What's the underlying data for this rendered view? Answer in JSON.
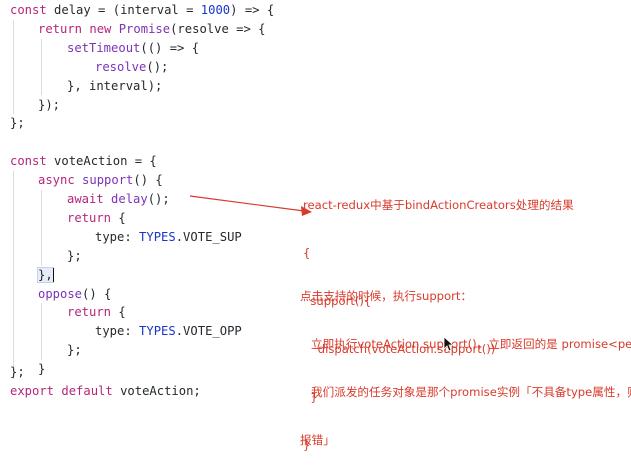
{
  "code": {
    "l1": {
      "kw1": "const ",
      "name": "delay",
      "mid": " = (interval = ",
      "num": "1000",
      "end": ") => {"
    },
    "l2": {
      "kw": "return new ",
      "cls": "Promise",
      "rest": "(resolve => {"
    },
    "l3": {
      "fn": "setTimeout",
      "rest": "(() => {"
    },
    "l4": {
      "fn": "resolve",
      "rest": "();"
    },
    "l5": "}, interval);",
    "l6": "});",
    "l7": "};",
    "l8": {
      "kw": "const ",
      "name": "voteAction",
      "rest": " = {"
    },
    "l9": {
      "kw": "async ",
      "fn": "support",
      "rest": "() {"
    },
    "l10": {
      "kw": "await ",
      "fn": "delay",
      "rest": "();"
    },
    "l11": {
      "kw": "return",
      "rest": " {"
    },
    "l12": {
      "key": "type: ",
      "const": "TYPES",
      "rest": ".VOTE_SUP"
    },
    "l13": "};",
    "l14": "},",
    "l15": {
      "fn": "oppose",
      "rest": "() {"
    },
    "l16": {
      "kw": "return",
      "rest": " {"
    },
    "l17": {
      "key": "type: ",
      "const": "TYPES",
      "rest": ".VOTE_OPP"
    },
    "l18": "};",
    "l19": "}",
    "l20": "};",
    "l21": {
      "kw": "export default ",
      "rest": "voteAction;"
    }
  },
  "annotations": {
    "note1": {
      "title": "react-redux中基于bindActionCreators处理的结果",
      "lines": [
        "{",
        "  support(){",
        "    dispatch(voteAction.support())",
        "  }",
        "}"
      ]
    },
    "note2": {
      "lines": [
        "点击支持的时候，执行support：",
        "   立即执行voteAction.support()，立即返回的是 promise<pending>",
        "   我们派发的任务对象是那个promise实例「不具备type属性，则",
        "报错」"
      ]
    }
  },
  "colors": {
    "annotation": "#d93a2b",
    "keyword": "#b4267c",
    "function": "#7c33b8",
    "number": "#1a35cc"
  }
}
